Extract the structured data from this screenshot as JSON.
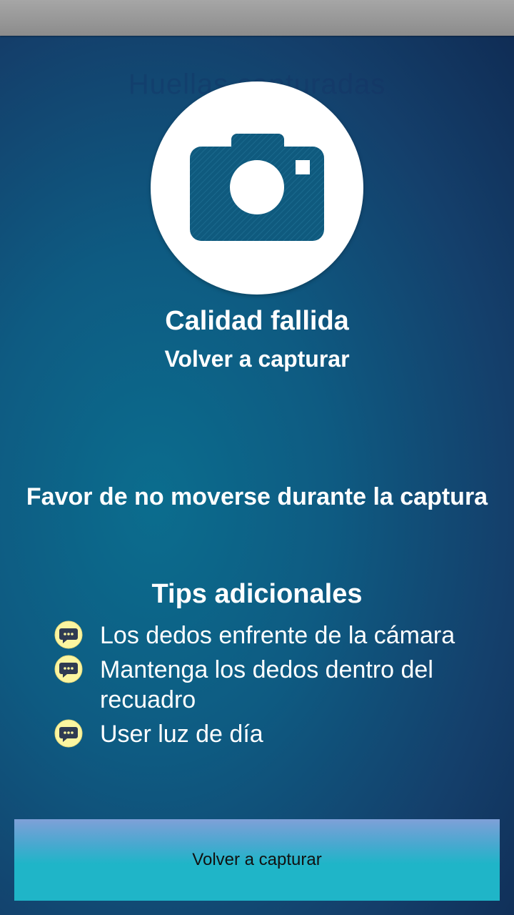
{
  "header": {
    "background_title": "Huellas capturadas"
  },
  "result": {
    "icon": "camera-icon",
    "title": "Calidad fallida",
    "subtitle": "Volver a capturar"
  },
  "instructions": {
    "warning": "Favor de no moverse durante la captura"
  },
  "tips": {
    "heading": "Tips adicionales",
    "icon": "chat-bubble-icon",
    "items": [
      {
        "text": "Los dedos enfrente de la cámara"
      },
      {
        "text": "Mantenga los dedos dentro del recuadro"
      },
      {
        "text": "User luz de día"
      }
    ]
  },
  "action": {
    "recapture_label": "Volver a capturar"
  },
  "colors": {
    "accent": "#1fb5c8",
    "camera_blue": "#0f5a7e",
    "bubble_yellow": "#fbf5a0"
  }
}
